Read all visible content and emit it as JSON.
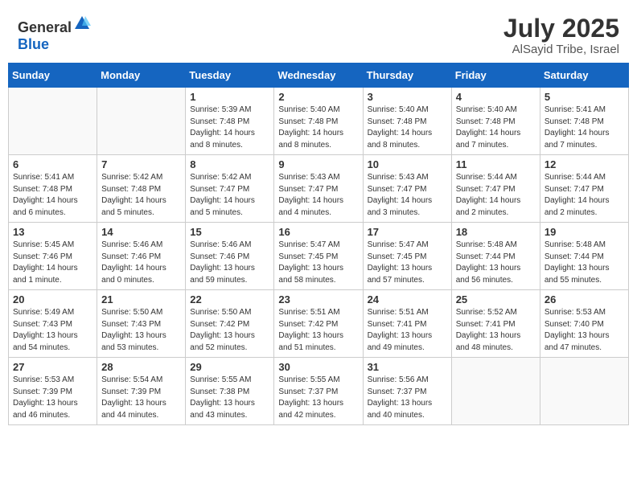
{
  "header": {
    "logo_general": "General",
    "logo_blue": "Blue",
    "month_year": "July 2025",
    "location": "AlSayid Tribe, Israel"
  },
  "days_of_week": [
    "Sunday",
    "Monday",
    "Tuesday",
    "Wednesday",
    "Thursday",
    "Friday",
    "Saturday"
  ],
  "weeks": [
    [
      {
        "day": "",
        "empty": true
      },
      {
        "day": "",
        "empty": true
      },
      {
        "day": "1",
        "sunrise": "Sunrise: 5:39 AM",
        "sunset": "Sunset: 7:48 PM",
        "daylight": "Daylight: 14 hours and 8 minutes."
      },
      {
        "day": "2",
        "sunrise": "Sunrise: 5:40 AM",
        "sunset": "Sunset: 7:48 PM",
        "daylight": "Daylight: 14 hours and 8 minutes."
      },
      {
        "day": "3",
        "sunrise": "Sunrise: 5:40 AM",
        "sunset": "Sunset: 7:48 PM",
        "daylight": "Daylight: 14 hours and 8 minutes."
      },
      {
        "day": "4",
        "sunrise": "Sunrise: 5:40 AM",
        "sunset": "Sunset: 7:48 PM",
        "daylight": "Daylight: 14 hours and 7 minutes."
      },
      {
        "day": "5",
        "sunrise": "Sunrise: 5:41 AM",
        "sunset": "Sunset: 7:48 PM",
        "daylight": "Daylight: 14 hours and 7 minutes."
      }
    ],
    [
      {
        "day": "6",
        "sunrise": "Sunrise: 5:41 AM",
        "sunset": "Sunset: 7:48 PM",
        "daylight": "Daylight: 14 hours and 6 minutes."
      },
      {
        "day": "7",
        "sunrise": "Sunrise: 5:42 AM",
        "sunset": "Sunset: 7:48 PM",
        "daylight": "Daylight: 14 hours and 5 minutes."
      },
      {
        "day": "8",
        "sunrise": "Sunrise: 5:42 AM",
        "sunset": "Sunset: 7:47 PM",
        "daylight": "Daylight: 14 hours and 5 minutes."
      },
      {
        "day": "9",
        "sunrise": "Sunrise: 5:43 AM",
        "sunset": "Sunset: 7:47 PM",
        "daylight": "Daylight: 14 hours and 4 minutes."
      },
      {
        "day": "10",
        "sunrise": "Sunrise: 5:43 AM",
        "sunset": "Sunset: 7:47 PM",
        "daylight": "Daylight: 14 hours and 3 minutes."
      },
      {
        "day": "11",
        "sunrise": "Sunrise: 5:44 AM",
        "sunset": "Sunset: 7:47 PM",
        "daylight": "Daylight: 14 hours and 2 minutes."
      },
      {
        "day": "12",
        "sunrise": "Sunrise: 5:44 AM",
        "sunset": "Sunset: 7:47 PM",
        "daylight": "Daylight: 14 hours and 2 minutes."
      }
    ],
    [
      {
        "day": "13",
        "sunrise": "Sunrise: 5:45 AM",
        "sunset": "Sunset: 7:46 PM",
        "daylight": "Daylight: 14 hours and 1 minute."
      },
      {
        "day": "14",
        "sunrise": "Sunrise: 5:46 AM",
        "sunset": "Sunset: 7:46 PM",
        "daylight": "Daylight: 14 hours and 0 minutes."
      },
      {
        "day": "15",
        "sunrise": "Sunrise: 5:46 AM",
        "sunset": "Sunset: 7:46 PM",
        "daylight": "Daylight: 13 hours and 59 minutes."
      },
      {
        "day": "16",
        "sunrise": "Sunrise: 5:47 AM",
        "sunset": "Sunset: 7:45 PM",
        "daylight": "Daylight: 13 hours and 58 minutes."
      },
      {
        "day": "17",
        "sunrise": "Sunrise: 5:47 AM",
        "sunset": "Sunset: 7:45 PM",
        "daylight": "Daylight: 13 hours and 57 minutes."
      },
      {
        "day": "18",
        "sunrise": "Sunrise: 5:48 AM",
        "sunset": "Sunset: 7:44 PM",
        "daylight": "Daylight: 13 hours and 56 minutes."
      },
      {
        "day": "19",
        "sunrise": "Sunrise: 5:48 AM",
        "sunset": "Sunset: 7:44 PM",
        "daylight": "Daylight: 13 hours and 55 minutes."
      }
    ],
    [
      {
        "day": "20",
        "sunrise": "Sunrise: 5:49 AM",
        "sunset": "Sunset: 7:43 PM",
        "daylight": "Daylight: 13 hours and 54 minutes."
      },
      {
        "day": "21",
        "sunrise": "Sunrise: 5:50 AM",
        "sunset": "Sunset: 7:43 PM",
        "daylight": "Daylight: 13 hours and 53 minutes."
      },
      {
        "day": "22",
        "sunrise": "Sunrise: 5:50 AM",
        "sunset": "Sunset: 7:42 PM",
        "daylight": "Daylight: 13 hours and 52 minutes."
      },
      {
        "day": "23",
        "sunrise": "Sunrise: 5:51 AM",
        "sunset": "Sunset: 7:42 PM",
        "daylight": "Daylight: 13 hours and 51 minutes."
      },
      {
        "day": "24",
        "sunrise": "Sunrise: 5:51 AM",
        "sunset": "Sunset: 7:41 PM",
        "daylight": "Daylight: 13 hours and 49 minutes."
      },
      {
        "day": "25",
        "sunrise": "Sunrise: 5:52 AM",
        "sunset": "Sunset: 7:41 PM",
        "daylight": "Daylight: 13 hours and 48 minutes."
      },
      {
        "day": "26",
        "sunrise": "Sunrise: 5:53 AM",
        "sunset": "Sunset: 7:40 PM",
        "daylight": "Daylight: 13 hours and 47 minutes."
      }
    ],
    [
      {
        "day": "27",
        "sunrise": "Sunrise: 5:53 AM",
        "sunset": "Sunset: 7:39 PM",
        "daylight": "Daylight: 13 hours and 46 minutes."
      },
      {
        "day": "28",
        "sunrise": "Sunrise: 5:54 AM",
        "sunset": "Sunset: 7:39 PM",
        "daylight": "Daylight: 13 hours and 44 minutes."
      },
      {
        "day": "29",
        "sunrise": "Sunrise: 5:55 AM",
        "sunset": "Sunset: 7:38 PM",
        "daylight": "Daylight: 13 hours and 43 minutes."
      },
      {
        "day": "30",
        "sunrise": "Sunrise: 5:55 AM",
        "sunset": "Sunset: 7:37 PM",
        "daylight": "Daylight: 13 hours and 42 minutes."
      },
      {
        "day": "31",
        "sunrise": "Sunrise: 5:56 AM",
        "sunset": "Sunset: 7:37 PM",
        "daylight": "Daylight: 13 hours and 40 minutes."
      },
      {
        "day": "",
        "empty": true
      },
      {
        "day": "",
        "empty": true
      }
    ]
  ]
}
